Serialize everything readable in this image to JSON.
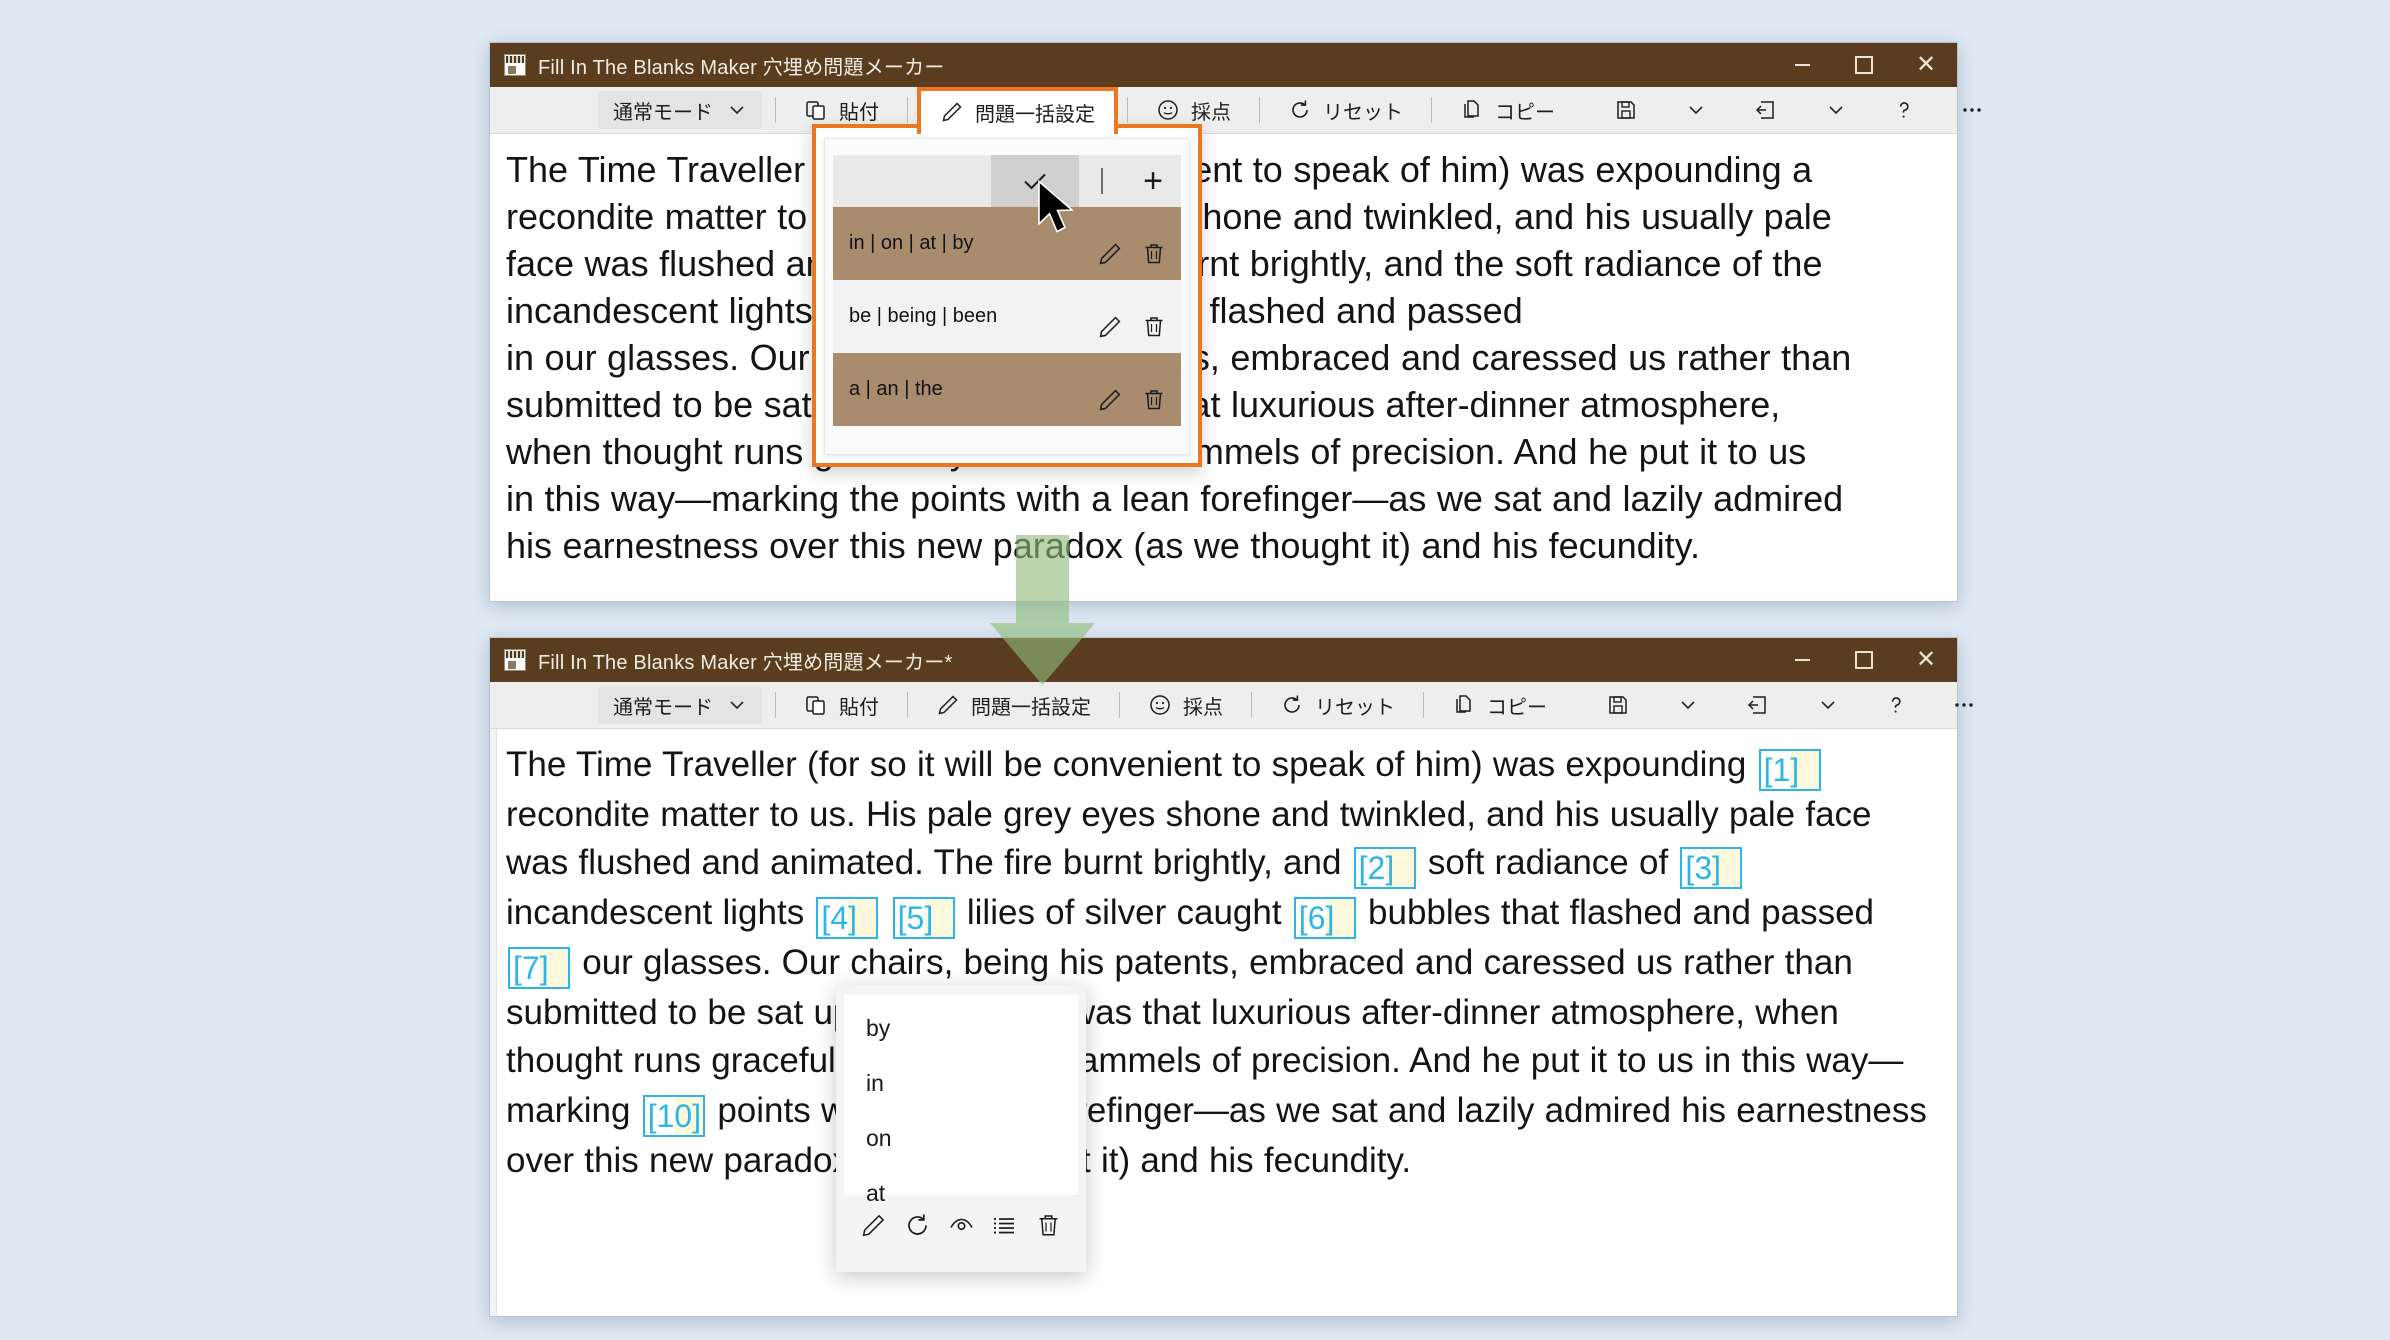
{
  "app": {
    "accent_orange": "#ec7722",
    "titlebar_color": "#5a3d1e",
    "blank_color": "#2eb5e8",
    "row_highlight_color": "#a98c6e"
  },
  "window_top": {
    "title": "Fill In The Blanks Maker 穴埋め問題メーカー",
    "icon": "app-icon",
    "controls": {
      "minimize": "−",
      "maximize": "□",
      "close": "✕"
    },
    "toolbar": {
      "mode_label": "通常モード",
      "mode_chevron": "⌄",
      "paste_label": "貼付",
      "bulk_label": "問題一括設定",
      "grade_label": "採点",
      "reset_label": "リセット",
      "copy_label": "コピー",
      "save_icon": "save-icon",
      "save_chevron": "⌄",
      "export_icon": "export-icon",
      "export_chevron": "⌄",
      "help_icon": "help-icon",
      "more_icon": "more-icon"
    },
    "document_lines": [
      "The Time Traveller (for so it will be convenient to speak of him) was expounding a",
      "recondite matter to us. His pale grey eyes shone and twinkled, and his usually pale",
      "face was flushed and animated. The fire burnt brightly, and the soft radiance of the",
      "incandescent lights caught the bubbles that flashed and passed",
      "in our glasses. Our chairs, being his patents, embraced and caressed us rather than",
      "submitted to be sat upon, and there was that luxurious after-dinner atmosphere,",
      "when thought runs gracefully free of the trammels of precision. And he put it to us",
      "in this way—marking the points with a lean forefinger—as we sat and lazily admired",
      "his earnestness over this new paradox (as we thought it) and his fecundity."
    ]
  },
  "bulk_popup": {
    "header": {
      "confirm_icon": "check-icon",
      "divider": "|",
      "add_label": "+"
    },
    "rows": [
      {
        "label": "in | on | at | by",
        "selected": true,
        "edit_icon": "pencil-icon",
        "delete_icon": "trash-icon"
      },
      {
        "label": "be | being | been",
        "selected": false,
        "edit_icon": "pencil-icon",
        "delete_icon": "trash-icon"
      },
      {
        "label": "a | an | the",
        "selected": true,
        "edit_icon": "pencil-icon",
        "delete_icon": "trash-icon"
      }
    ]
  },
  "cursor": {
    "name": "mouse-pointer"
  },
  "flow_arrow": {
    "name": "down-arrow",
    "color": "#9cc189"
  },
  "window_bottom": {
    "title": "Fill In The Blanks Maker 穴埋め問題メーカー*",
    "icon": "app-icon",
    "controls": {
      "minimize": "−",
      "maximize": "□",
      "close": "✕"
    },
    "toolbar": {
      "mode_label": "通常モード",
      "mode_chevron": "⌄",
      "paste_label": "貼付",
      "bulk_label": "問題一括設定",
      "grade_label": "採点",
      "reset_label": "リセット",
      "copy_label": "コピー",
      "save_icon": "save-icon",
      "save_chevron": "⌄",
      "export_icon": "export-icon",
      "export_chevron": "⌄",
      "help_icon": "help-icon",
      "more_icon": "more-icon"
    },
    "document_segments": [
      {
        "t": "text",
        "v": "The Time Traveller (for so it will be convenient to speak of him) was expounding "
      },
      {
        "t": "blank",
        "v": "[1]"
      },
      {
        "t": "text",
        "v": " recondite matter to us. His pale grey eyes shone and twinkled, and his usually pale face was flushed and animated. The fire burnt brightly, and "
      },
      {
        "t": "blank",
        "v": "[2]"
      },
      {
        "t": "text",
        "v": " soft radiance of "
      },
      {
        "t": "blank",
        "v": "[3]"
      },
      {
        "t": "text",
        "v": " incandescent lights "
      },
      {
        "t": "blank",
        "v": "[4]"
      },
      {
        "t": "text",
        "v": " "
      },
      {
        "t": "blank",
        "v": "[5]"
      },
      {
        "t": "text",
        "v": " lilies of silver caught "
      },
      {
        "t": "blank",
        "v": "[6]"
      },
      {
        "t": "text",
        "v": " bubbles that flashed and passed "
      },
      {
        "t": "blank",
        "v": "[7]"
      },
      {
        "t": "text",
        "v": " our glasses. Our chairs, being his patents, embraced and caressed us rather than submitted to be sat upon, and there was that luxurious after-dinner atmosphere, when thought runs gracefully free of "
      },
      {
        "t": "blank",
        "v": "[8]"
      },
      {
        "t": "text",
        "v": " trammels of precision. And he put it to us in this way—marking "
      },
      {
        "t": "blank",
        "v": "[10]"
      },
      {
        "t": "text",
        "v": " points with "
      },
      {
        "t": "blank",
        "v": "[11]"
      },
      {
        "t": "text",
        "v": " lean forefinger—as we sat and lazily admired his earnestness over this new paradox (as we thought it) and his fecundity."
      }
    ]
  },
  "choice_popup": {
    "options": [
      "by",
      "in",
      "on",
      "at"
    ],
    "footer_icons": [
      "pencil-icon",
      "reset-icon",
      "eye-icon",
      "list-icon",
      "trash-icon"
    ]
  }
}
